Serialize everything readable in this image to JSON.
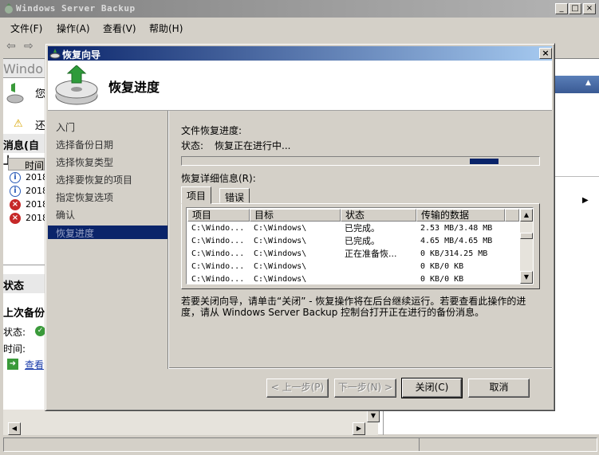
{
  "main_window": {
    "title": "Windows Server Backup",
    "menu": [
      "文件(F)",
      "操作(A)",
      "查看(V)",
      "帮助(H)"
    ],
    "left_pane": {
      "header_text": "Windo",
      "subtitle": "您",
      "warning_text": "还",
      "messages_header": "消息(自上",
      "messages_column": "时间",
      "message_rows": [
        {
          "type": "info",
          "time": "2018"
        },
        {
          "type": "info",
          "time": "2018"
        },
        {
          "type": "error",
          "time": "2018"
        },
        {
          "type": "error",
          "time": "2018"
        }
      ],
      "status_header": "状态",
      "last_backup_header": "上次备份",
      "status_label": "状态:",
      "time_label": "时间:",
      "view_link": "查看"
    }
  },
  "dialog": {
    "title": "恢复向导",
    "banner_title": "恢复进度",
    "nav_items": [
      {
        "label": "入门",
        "active": false
      },
      {
        "label": "选择备份日期",
        "active": false
      },
      {
        "label": "选择恢复类型",
        "active": false
      },
      {
        "label": "选择要恢复的项目",
        "active": false
      },
      {
        "label": "指定恢复选项",
        "active": false
      },
      {
        "label": "确认",
        "active": false
      },
      {
        "label": "恢复进度",
        "active": true
      }
    ],
    "file_progress_label": "文件恢复进度:",
    "status_label": "状态:",
    "status_value": "恢复正在进行中...",
    "progress_indicator_fraction": [
      0.81,
      0.89
    ],
    "details_label": "恢复详细信息(R):",
    "tabs": [
      "项目",
      "错误"
    ],
    "columns": [
      "项目",
      "目标",
      "状态",
      "传输的数据"
    ],
    "rows": [
      {
        "item": "C:\\Windo...",
        "target": "C:\\Windows\\",
        "status": "已完成。",
        "data": "2.53 MB/3.48 MB"
      },
      {
        "item": "C:\\Windo...",
        "target": "C:\\Windows\\",
        "status": "已完成。",
        "data": "4.65 MB/4.65 MB"
      },
      {
        "item": "C:\\Windo...",
        "target": "C:\\Windows\\",
        "status": "正在准备恢...",
        "data": "0 KB/314.25 MB"
      },
      {
        "item": "C:\\Windo...",
        "target": "C:\\Windows\\",
        "status": "",
        "data": "0 KB/0 KB"
      },
      {
        "item": "C:\\Windo...",
        "target": "C:\\Windows\\",
        "status": "",
        "data": "0 KB/0 KB"
      }
    ],
    "info_line1": "若要关闭向导，请单击“关闭” - 恢复操作将在后台继续运行。若要查看此操作的进",
    "info_line2": "度，请从 Windows Server Backup 控制台打开正在进行的备份消息。",
    "buttons": {
      "back": "< 上一步(P)",
      "next": "下一步(N) >",
      "close": "关闭(C)",
      "cancel": "取消"
    }
  }
}
